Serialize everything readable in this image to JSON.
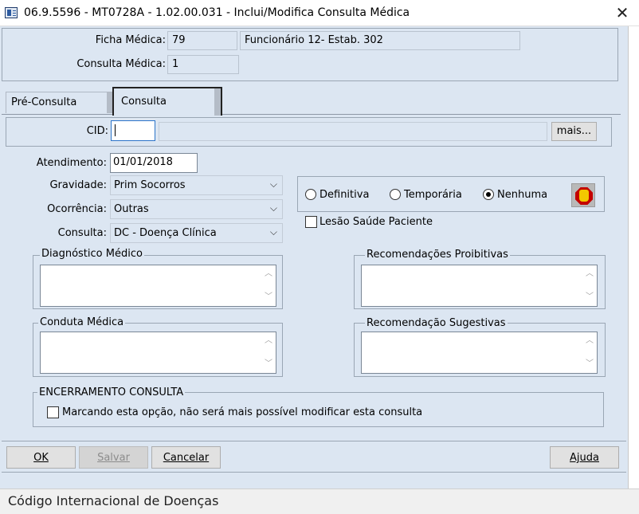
{
  "window": {
    "title": "06.9.5596 - MT0728A - 1.02.00.031 - Inclui/Modifica Consulta Médica",
    "close_glyph": "✕"
  },
  "header": {
    "ficha_label": "Ficha Médica:",
    "ficha_value": "79",
    "ficha_desc": "Funcionário 12- Estab. 302",
    "consulta_label": "Consulta Médica:",
    "consulta_value": "1"
  },
  "tabs": [
    {
      "label": "Pré-Consulta",
      "active": false
    },
    {
      "label": "Consulta",
      "active": true
    }
  ],
  "cid": {
    "label": "CID:",
    "value": "",
    "description": "",
    "mais_button": "mais..."
  },
  "form": {
    "atendimento_label": "Atendimento:",
    "atendimento_value": "01/01/2018",
    "gravidade_label": "Gravidade:",
    "gravidade_value": "Prim Socorros",
    "ocorrencia_label": "Ocorrência:",
    "ocorrencia_value": "Outras",
    "consulta_label": "Consulta:",
    "consulta_value": "DC - Doença Clínica"
  },
  "diagnosis_type": {
    "options": [
      "Definitiva",
      "Temporária",
      "Nenhuma"
    ],
    "selected": "Nenhuma"
  },
  "lesao": {
    "label": "Lesão Saúde Paciente",
    "checked": false
  },
  "groups": {
    "diagnostico": "Diagnóstico Médico",
    "conduta": "Conduta Médica",
    "proibitivas": "Recomendações Proibitivas",
    "sugestivas": "Recomendação Sugestivas"
  },
  "encerramento": {
    "title": "ENCERRAMENTO CONSULTA",
    "checkbox_label": "Marcando esta opção, não será mais possível modificar esta consulta",
    "checked": false
  },
  "buttons": {
    "ok": "OK",
    "salvar": "Salvar",
    "cancelar": "Cancelar",
    "ajuda": "Ajuda"
  },
  "status_bar": {
    "text": "Código Internacional de Doenças"
  },
  "icons": {
    "app": "form-window-icon",
    "stop": "stop-hand-icon"
  },
  "colors": {
    "window_bg": "#dce6f2",
    "stop_red": "#c40000"
  }
}
